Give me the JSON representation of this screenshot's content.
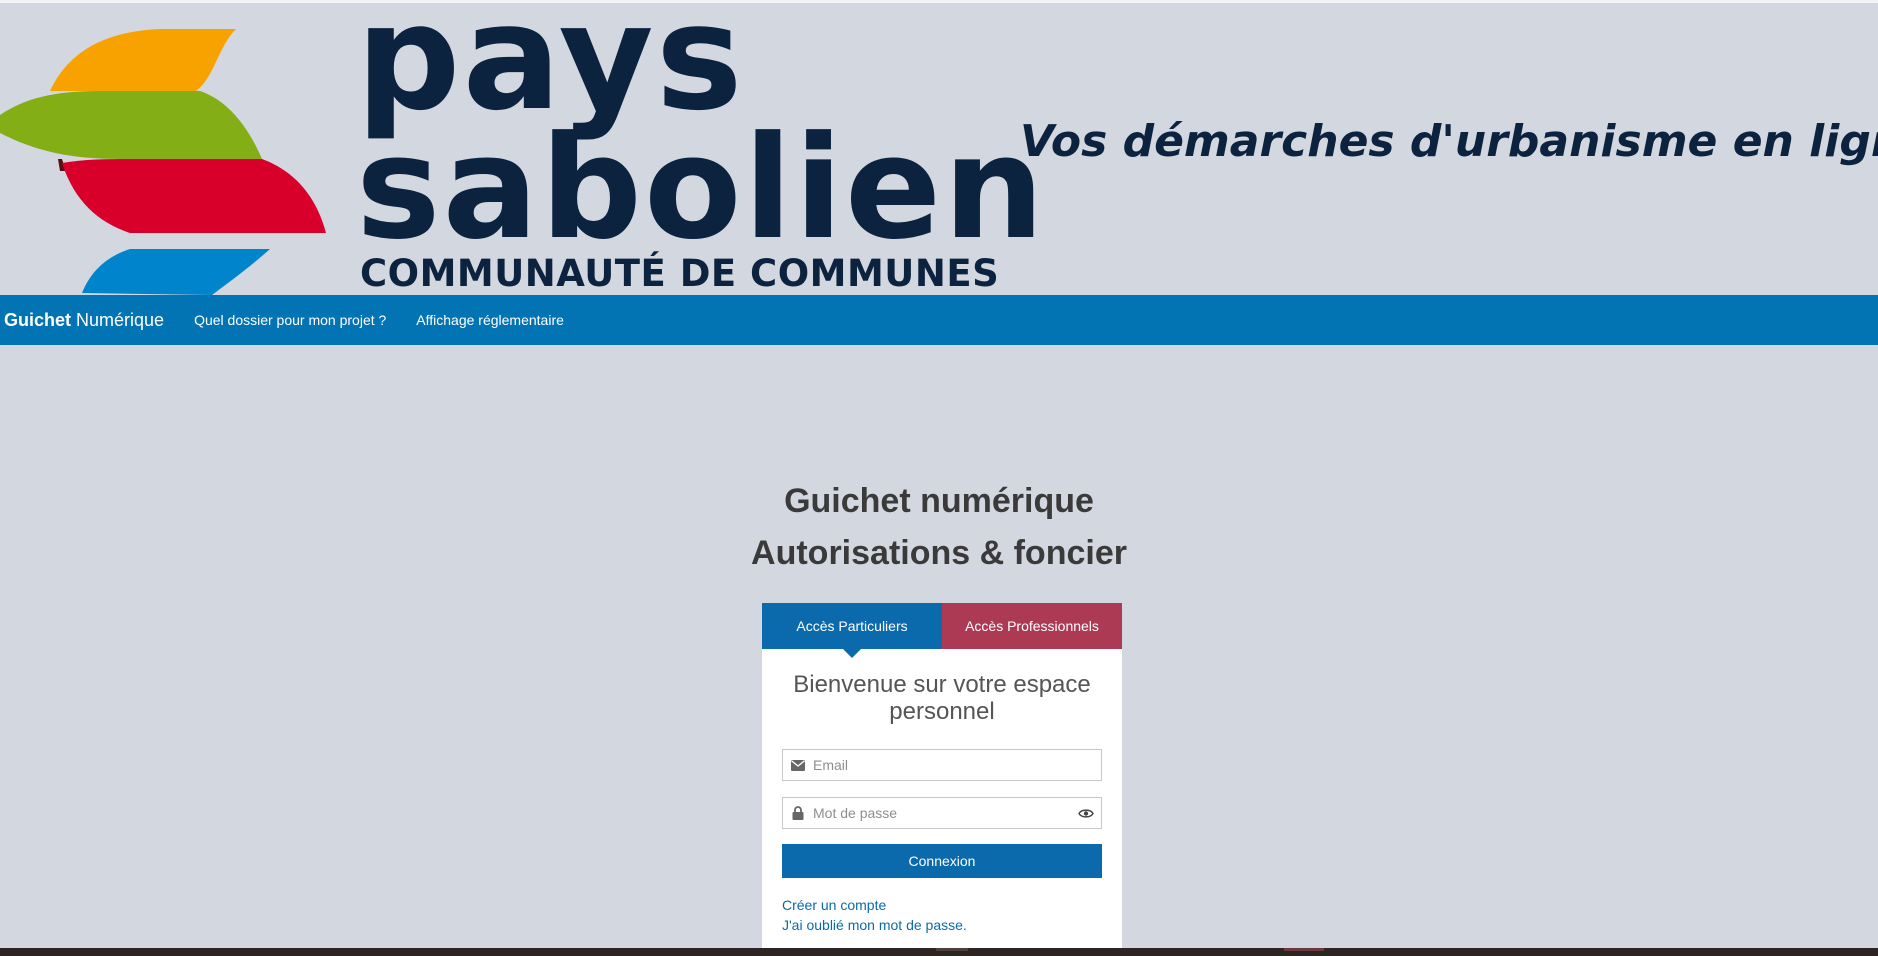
{
  "banner": {
    "logo_line1": "pays",
    "logo_line2": "sabolien",
    "logo_subtitle": "COMMUNAUTÉ DE COMMUNES",
    "tagline": "Vos démarches d'urbanisme en ligne",
    "logo_colors": [
      "#f8a200",
      "#84ae16",
      "#d8002a",
      "#0085cc"
    ],
    "brand_text_color": "#0c2340"
  },
  "navbar": {
    "brand_strong": "Guichet",
    "brand_rest": "Numérique",
    "links": [
      "Quel dossier pour mon projet ?",
      "Affichage réglementaire"
    ],
    "background_color": "#0274b3"
  },
  "heading": {
    "title": "Guichet numérique",
    "subtitle": "Autorisations & foncier"
  },
  "login": {
    "tabs": [
      {
        "label": "Accès Particuliers",
        "active": true,
        "color": "#0b6aab"
      },
      {
        "label": "Accès Professionnels",
        "active": false,
        "color": "#ad3a54"
      }
    ],
    "welcome": "Bienvenue sur votre espace personnel",
    "email_placeholder": "Email",
    "email_value": "",
    "password_placeholder": "Mot de passe",
    "password_value": "",
    "submit_label": "Connexion",
    "create_account": "Créer un compte",
    "forgot_password": "J'ai oublié mon mot de passe.",
    "icons": [
      "envelope-icon",
      "lock-icon",
      "eye-icon"
    ]
  }
}
